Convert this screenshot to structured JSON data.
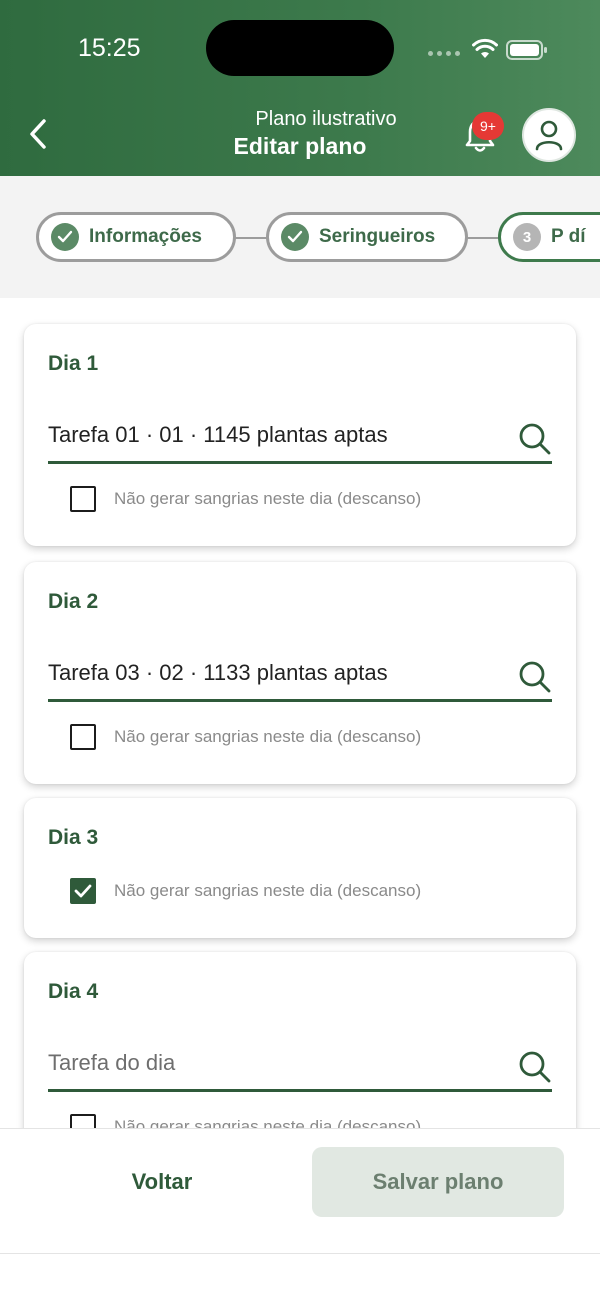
{
  "status_bar": {
    "time": "15:25"
  },
  "header": {
    "subtitle": "Plano ilustrativo",
    "title": "Editar plano",
    "notification_badge": "9+"
  },
  "stepper": {
    "steps": [
      {
        "label": "Informações",
        "state": "done"
      },
      {
        "label": "Seringueiros",
        "state": "done"
      },
      {
        "number": "3",
        "label": "Por dia",
        "visible_label": "P dí",
        "state": "current"
      }
    ]
  },
  "days": [
    {
      "title": "Dia 1",
      "task": "Tarefa 01 · 01 · 1145 plantas aptas",
      "rest_checked": false
    },
    {
      "title": "Dia 2",
      "task": "Tarefa 03 · 02 · 1133 plantas aptas",
      "rest_checked": false
    },
    {
      "title": "Dia 3",
      "task": "",
      "rest_checked": true
    },
    {
      "title": "Dia 4",
      "task": "",
      "placeholder": "Tarefa do dia",
      "rest_checked": false
    }
  ],
  "rest_label": "Não gerar sangrias neste dia (descanso)",
  "footer": {
    "back_label": "Voltar",
    "save_label": "Salvar plano"
  },
  "colors": {
    "primary": "#2f5a3a",
    "header": "#3d7a4c",
    "badge": "#e53935",
    "disabled_button": "#e1e8e2"
  }
}
